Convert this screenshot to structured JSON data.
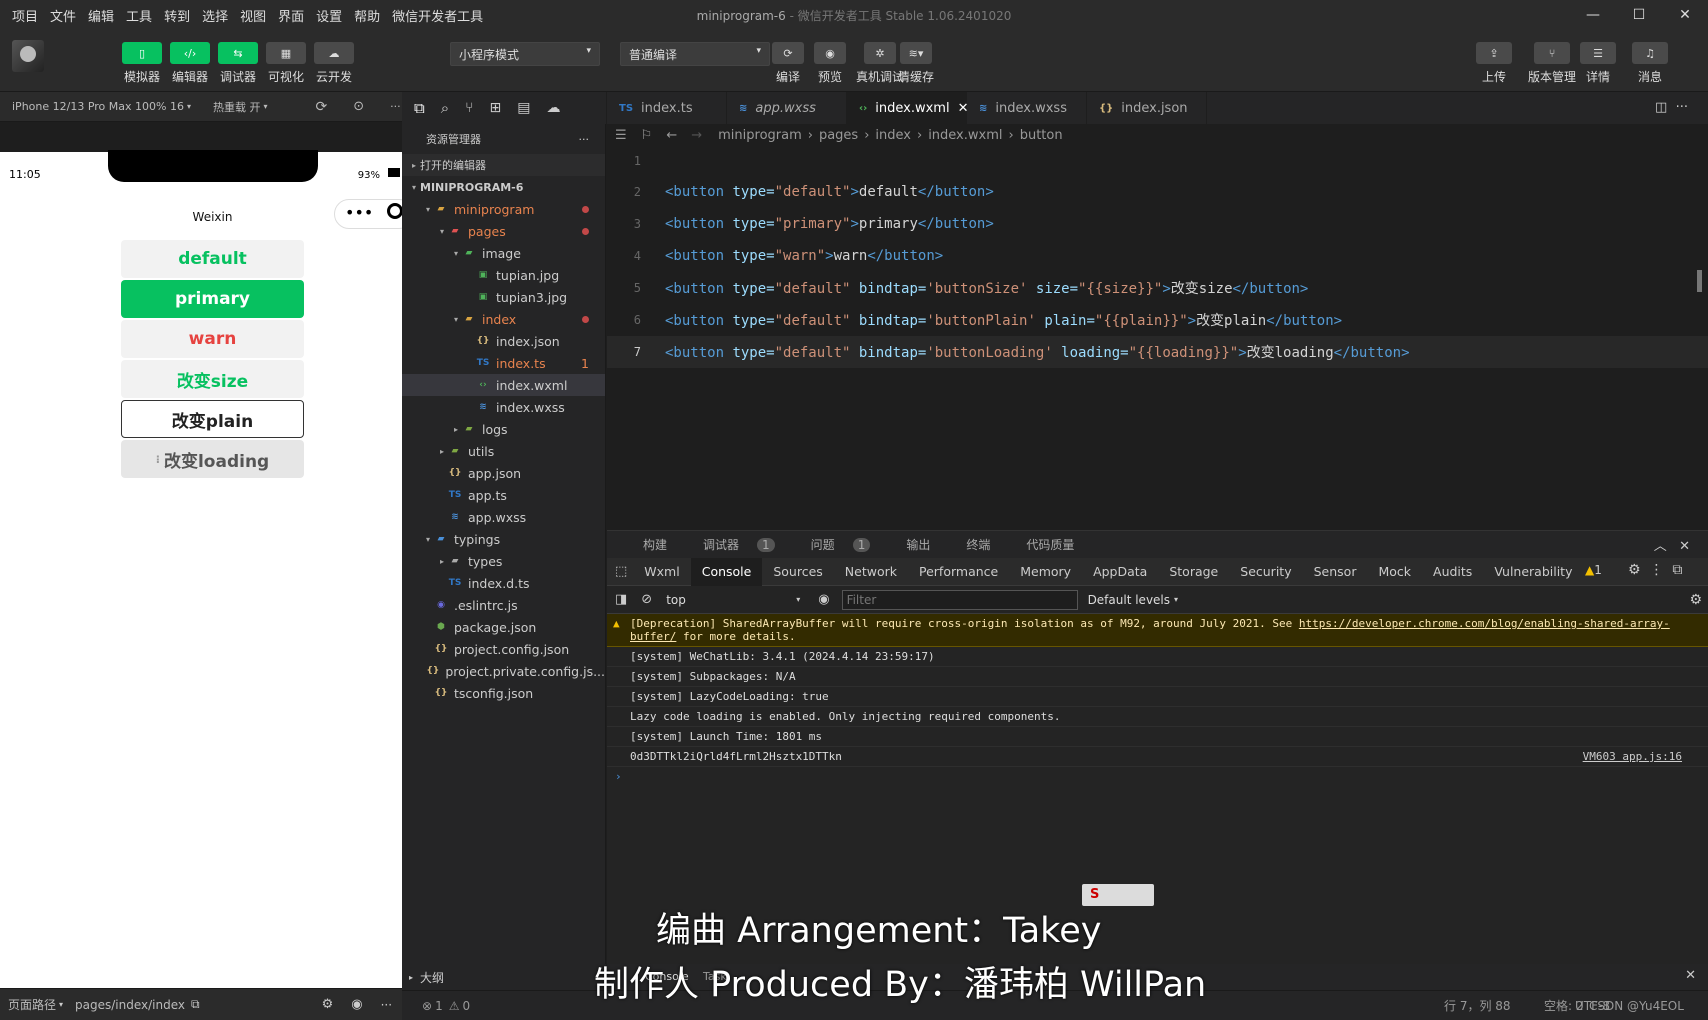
{
  "menu": [
    "项目",
    "文件",
    "编辑",
    "工具",
    "转到",
    "选择",
    "视图",
    "界面",
    "设置",
    "帮助",
    "微信开发者工具"
  ],
  "window_title": "miniprogram-6",
  "window_subtitle": " - 微信开发者工具 Stable 1.06.2401020",
  "toolbar": {
    "left": [
      {
        "label": "模拟器",
        "icon": "phone-icon"
      },
      {
        "label": "编辑器",
        "icon": "code-icon"
      },
      {
        "label": "调试器",
        "icon": "debug-icon"
      },
      {
        "label": "可视化",
        "icon": "layout-icon"
      },
      {
        "label": "云开发",
        "icon": "cloud-icon"
      }
    ],
    "mode_select": "小程序模式",
    "compile_select": "普通编译",
    "mid": [
      {
        "label": "编译",
        "icon": "refresh-icon"
      },
      {
        "label": "预览",
        "icon": "eye-icon"
      },
      {
        "label": "真机调试",
        "icon": "bug-icon"
      },
      {
        "label": "清缓存",
        "icon": "layers-icon"
      }
    ],
    "right": [
      {
        "label": "上传",
        "icon": "upload-icon"
      },
      {
        "label": "版本管理",
        "icon": "branch-icon"
      },
      {
        "label": "详情",
        "icon": "menu-icon"
      },
      {
        "label": "消息",
        "icon": "bell-icon"
      }
    ]
  },
  "sim": {
    "device": "iPhone 12/13 Pro Max 100% 16",
    "hot_reload": "热重载 开",
    "time": "11:05",
    "battery": "93%",
    "nav_title": "Weixin",
    "buttons": [
      {
        "label": "default",
        "color": "#07c160"
      },
      {
        "label": "primary",
        "color": "#ffffff"
      },
      {
        "label": "warn",
        "color": "#e64340"
      },
      {
        "label": "改变size",
        "color": "#07c160"
      },
      {
        "label": "改变plain",
        "color": "#222222"
      },
      {
        "label": "改变loading",
        "color": "#555555"
      }
    ],
    "footer_path_label": "页面路径",
    "footer_path": "pages/index/index"
  },
  "explorer": {
    "title": "资源管理器",
    "open_editors": "打开的编辑器",
    "project": "MINIPROGRAM-6",
    "items": [
      {
        "label": "miniprogram",
        "indent": 1,
        "arrow": "▾",
        "type": "folder",
        "color": "#e8834e",
        "dot": true
      },
      {
        "label": "pages",
        "indent": 2,
        "arrow": "▾",
        "type": "folder-red",
        "color": "#e8834e",
        "dot": true
      },
      {
        "label": "image",
        "indent": 3,
        "arrow": "▾",
        "type": "folder-img",
        "color": "#ccc"
      },
      {
        "label": "tupian.jpg",
        "indent": 4,
        "arrow": "",
        "type": "img",
        "color": "#ccc"
      },
      {
        "label": "tupian3.jpg",
        "indent": 4,
        "arrow": "",
        "type": "img",
        "color": "#ccc"
      },
      {
        "label": "index",
        "indent": 3,
        "arrow": "▾",
        "type": "folder",
        "color": "#e8834e",
        "dot": true
      },
      {
        "label": "index.json",
        "indent": 4,
        "arrow": "",
        "type": "json",
        "color": "#ccc"
      },
      {
        "label": "index.ts",
        "indent": 4,
        "arrow": "",
        "type": "ts",
        "color": "#e8834e",
        "count": "1"
      },
      {
        "label": "index.wxml",
        "indent": 4,
        "arrow": "",
        "type": "wxml",
        "color": "#ccc",
        "active": true
      },
      {
        "label": "index.wxss",
        "indent": 4,
        "arrow": "",
        "type": "wxss",
        "color": "#ccc"
      },
      {
        "label": "logs",
        "indent": 3,
        "arrow": "▸",
        "type": "folder-g",
        "color": "#ccc"
      },
      {
        "label": "utils",
        "indent": 2,
        "arrow": "▸",
        "type": "folder-g",
        "color": "#ccc"
      },
      {
        "label": "app.json",
        "indent": 2,
        "arrow": "",
        "type": "json",
        "color": "#ccc"
      },
      {
        "label": "app.ts",
        "indent": 2,
        "arrow": "",
        "type": "ts",
        "color": "#ccc"
      },
      {
        "label": "app.wxss",
        "indent": 2,
        "arrow": "",
        "type": "wxss",
        "color": "#ccc"
      },
      {
        "label": "typings",
        "indent": 1,
        "arrow": "▾",
        "type": "folder-b",
        "color": "#ccc"
      },
      {
        "label": "types",
        "indent": 2,
        "arrow": "▸",
        "type": "folder-w",
        "color": "#ccc"
      },
      {
        "label": "index.d.ts",
        "indent": 2,
        "arrow": "",
        "type": "ts",
        "color": "#ccc"
      },
      {
        "label": ".eslintrc.js",
        "indent": 1,
        "arrow": "",
        "type": "eslint",
        "color": "#ccc"
      },
      {
        "label": "package.json",
        "indent": 1,
        "arrow": "",
        "type": "pkg",
        "color": "#ccc"
      },
      {
        "label": "project.config.json",
        "indent": 1,
        "arrow": "",
        "type": "json",
        "color": "#ccc"
      },
      {
        "label": "project.private.config.js...",
        "indent": 1,
        "arrow": "",
        "type": "json",
        "color": "#ccc"
      },
      {
        "label": "tsconfig.json",
        "indent": 1,
        "arrow": "",
        "type": "json",
        "color": "#ccc"
      }
    ],
    "outline": "大纲",
    "status_errors": "1",
    "status_warnings": "0"
  },
  "tabs": [
    {
      "label": "index.ts",
      "type": "ts"
    },
    {
      "label": "app.wxss",
      "type": "wxss"
    },
    {
      "label": "index.wxml",
      "type": "wxml",
      "active": true
    },
    {
      "label": "index.wxss",
      "type": "wxss"
    },
    {
      "label": "index.json",
      "type": "json"
    }
  ],
  "breadcrumb": [
    "miniprogram",
    "pages",
    "index",
    "index.wxml",
    "button"
  ],
  "code": [
    {
      "n": "1",
      "parts": []
    },
    {
      "n": "2",
      "parts": [
        [
          "tg",
          "<button "
        ],
        [
          "at",
          "type="
        ],
        [
          "st",
          "\"default\""
        ],
        [
          "tg",
          ">"
        ],
        [
          "tx",
          "default"
        ],
        [
          "tg",
          "</button>"
        ]
      ]
    },
    {
      "n": "3",
      "parts": [
        [
          "tg",
          "<button "
        ],
        [
          "at",
          "type="
        ],
        [
          "st",
          "\"primary\""
        ],
        [
          "tg",
          ">"
        ],
        [
          "tx",
          "primary"
        ],
        [
          "tg",
          "</button>"
        ]
      ]
    },
    {
      "n": "4",
      "parts": [
        [
          "tg",
          "<button "
        ],
        [
          "at",
          "type="
        ],
        [
          "st",
          "\"warn\""
        ],
        [
          "tg",
          ">"
        ],
        [
          "tx",
          "warn"
        ],
        [
          "tg",
          "</button>"
        ]
      ]
    },
    {
      "n": "5",
      "parts": [
        [
          "tg",
          "<button "
        ],
        [
          "at",
          "type="
        ],
        [
          "st",
          "\"default\""
        ],
        [
          "at",
          " bindtap="
        ],
        [
          "st",
          "'buttonSize'"
        ],
        [
          "at",
          " size="
        ],
        [
          "st",
          "\"{{size}}\""
        ],
        [
          "tg",
          ">"
        ],
        [
          "tx",
          "改变size"
        ],
        [
          "tg",
          "</button>"
        ]
      ]
    },
    {
      "n": "6",
      "parts": [
        [
          "tg",
          "<button "
        ],
        [
          "at",
          "type="
        ],
        [
          "st",
          "\"default\""
        ],
        [
          "at",
          " bindtap="
        ],
        [
          "st",
          "'buttonPlain'"
        ],
        [
          "at",
          " plain="
        ],
        [
          "st",
          "\"{{plain}}\""
        ],
        [
          "tg",
          ">"
        ],
        [
          "tx",
          "改变plain"
        ],
        [
          "tg",
          "</button>"
        ]
      ]
    },
    {
      "n": "7",
      "parts": [
        [
          "tg",
          "<button "
        ],
        [
          "at",
          "type="
        ],
        [
          "st",
          "\"default\""
        ],
        [
          "at",
          " bindtap="
        ],
        [
          "st",
          "'buttonLoading'"
        ],
        [
          "at",
          " loading="
        ],
        [
          "st",
          "\"{{loading}}\""
        ],
        [
          "tg",
          ">"
        ],
        [
          "tx",
          "改变loading"
        ],
        [
          "tg",
          "</button>"
        ]
      ],
      "current": true
    }
  ],
  "devtools": {
    "top_tabs": [
      {
        "label": "构建"
      },
      {
        "label": "调试器",
        "badge": "1"
      },
      {
        "label": "问题",
        "badge": "1"
      },
      {
        "label": "输出"
      },
      {
        "label": "终端"
      },
      {
        "label": "代码质量"
      }
    ],
    "tabs": [
      "Wxml",
      "Console",
      "Sources",
      "Network",
      "Performance",
      "Memory",
      "AppData",
      "Storage",
      "Security",
      "Sensor",
      "Mock",
      "Audits",
      "Vulnerability"
    ],
    "active_tab": "Console",
    "warn_count": "1",
    "context": "top",
    "filter_placeholder": "Filter",
    "levels": "Default levels",
    "messages": [
      {
        "type": "warn",
        "text": "[Deprecation] SharedArrayBuffer will require cross-origin isolation as of M92, around July 2021. See ",
        "link": "https://developer.chrome.com/blog/enabling-shared-array-buffer/",
        "tail": " for more details."
      },
      {
        "type": "log",
        "text": "[system] WeChatLib: 3.4.1 (2024.4.14 23:59:17)"
      },
      {
        "type": "log",
        "text": "[system] Subpackages: N/A"
      },
      {
        "type": "log",
        "text": "[system] LazyCodeLoading: true"
      },
      {
        "type": "log",
        "text": "Lazy code loading is enabled. Only injecting required components."
      },
      {
        "type": "log",
        "text": "[system] Launch Time: 1801 ms"
      },
      {
        "type": "log",
        "text": "0d3DTTkl2iQrld4fLrml2Hsztx1DTTkn",
        "source": "VM603 app.js:16"
      }
    ],
    "bottom_tabs": [
      "Console",
      "Task"
    ]
  },
  "status": {
    "pos": "行 7，列 88",
    "indent": "空格: 2",
    "enc": "UTF-8",
    "lang": "CSDN @Yu4EOL"
  },
  "watermark": {
    "line1": "编曲 Arrangement：Takey",
    "line2": "制作人 Produced By：潘玮柏 WillPan"
  }
}
